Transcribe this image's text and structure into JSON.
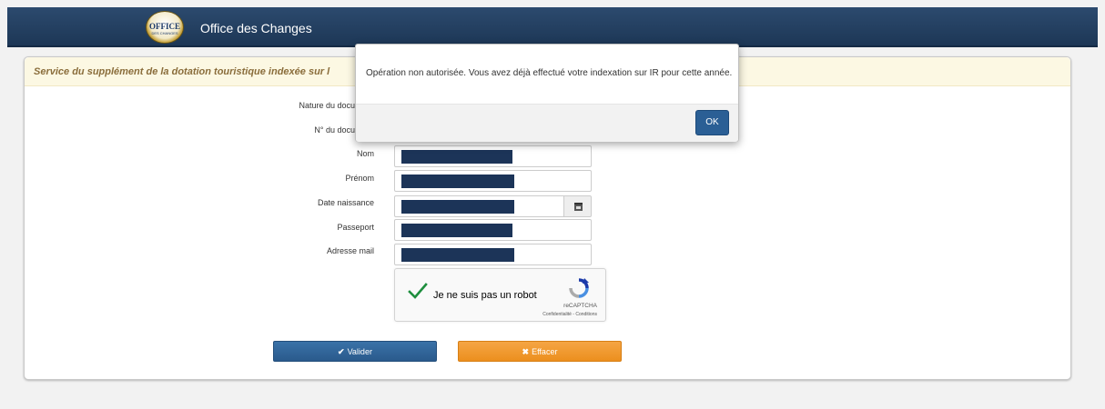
{
  "header": {
    "logo": {
      "line1": "OFFICE",
      "line2": "DES CHANGES",
      "icon": "office-des-changes-logo"
    },
    "title": "Office des Changes"
  },
  "panel": {
    "title": "Service du supplément de la dotation touristique indexée sur l",
    "fields": {
      "nature": {
        "label": "Nature du docu"
      },
      "numero": {
        "label": "N° du docu"
      },
      "nom": {
        "label": "Nom"
      },
      "prenom": {
        "label": "Prénom"
      },
      "date_naissance": {
        "label": "Date naissance",
        "icon": "calendar-icon"
      },
      "passeport": {
        "label": "Passeport"
      },
      "adresse_mail": {
        "label": "Adresse mail"
      }
    },
    "captcha": {
      "label": "Je ne suis pas un robot",
      "brand": "reCAPTCHA",
      "links": "Confidentialité - Conditions",
      "checked": true,
      "check_color": "#1e8e3e"
    },
    "buttons": {
      "valider": {
        "label": "Valider",
        "icon": "check-icon",
        "color": "#2a5a8c"
      },
      "effacer": {
        "label": "Effacer",
        "icon": "times-icon",
        "color": "#ec8f1e"
      }
    }
  },
  "modal": {
    "message": "Opération non autorisée. Vous avez déjà effectué votre indexation sur IR pour cette année.",
    "ok_label": "OK"
  }
}
